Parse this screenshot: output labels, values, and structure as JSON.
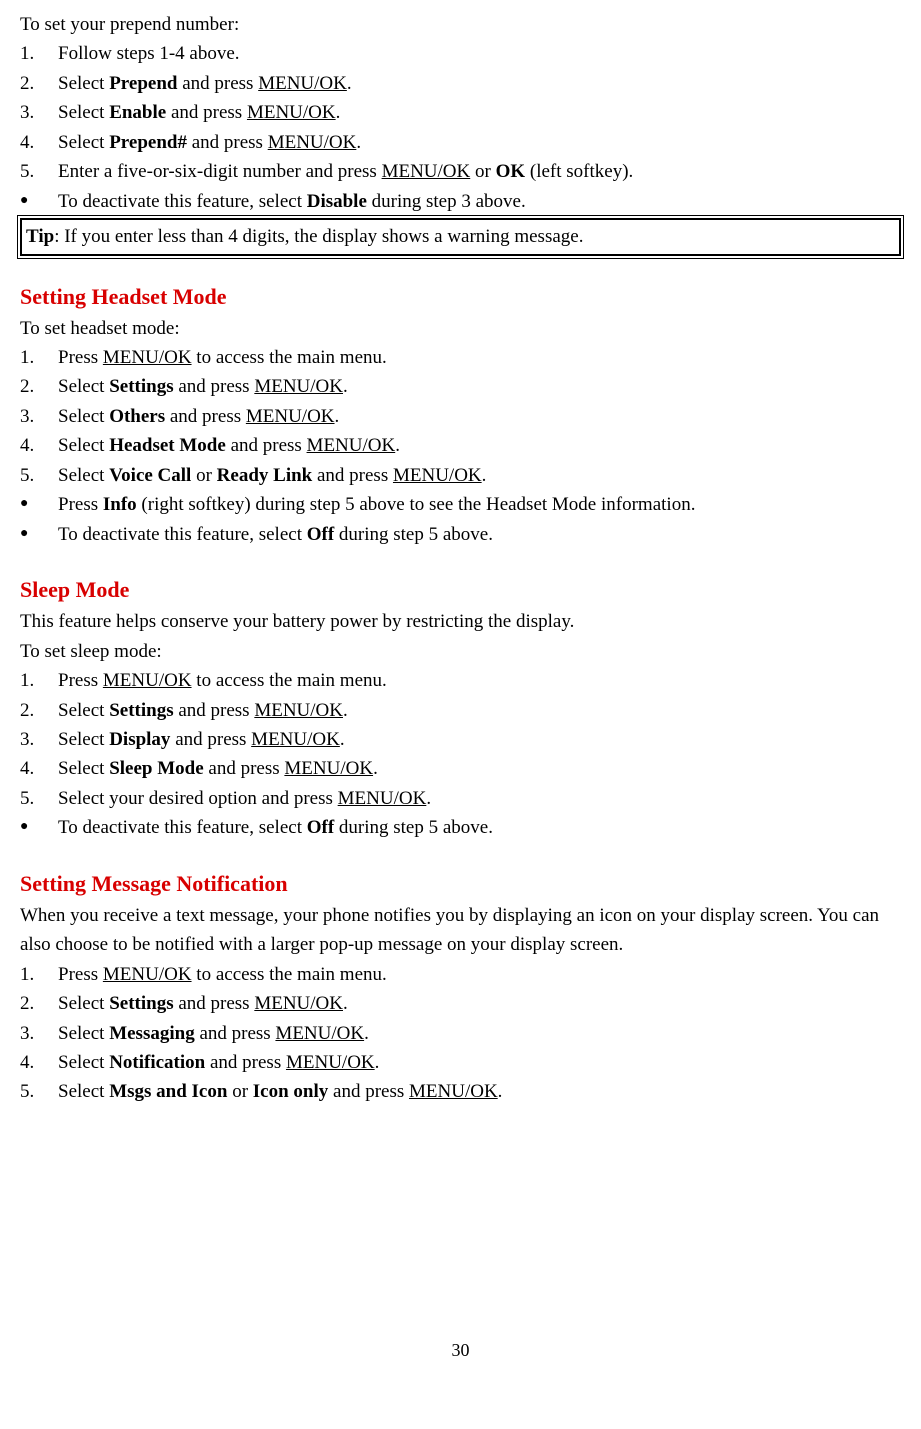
{
  "prepend": {
    "intro": "To set your prepend number:",
    "steps": [
      {
        "num": "1.",
        "html": "Follow steps 1-4 above."
      },
      {
        "num": "2.",
        "html": "Select <span class='b'>Prepend</span> and press <span class='key'>MENU/OK</span>."
      },
      {
        "num": "3.",
        "html": "Select <span class='b'>Enable</span> and press <span class='key'>MENU/OK</span>."
      },
      {
        "num": "4.",
        "html": "Select <span class='b'>Prepend#</span> and press <span class='key'>MENU/OK</span>."
      },
      {
        "num": "5.",
        "html": "Enter a five-or-six-digit number and press <span class='key'>MENU/OK</span> or <span class='b'>OK</span> (left softkey)."
      }
    ],
    "notes": [
      "To deactivate this feature, select <span class='b'>Disable</span> during step 3 above."
    ],
    "tip": "<span class='b'>Tip</span>: If you enter less than 4 digits, the display shows a warning message."
  },
  "headset": {
    "title": "Setting Headset Mode",
    "intro": "To set headset mode:",
    "steps": [
      {
        "num": "1.",
        "html": "Press <span class='key'>MENU/OK</span> to access the main menu."
      },
      {
        "num": "2.",
        "html": "Select <span class='b'>Settings</span> and press <span class='key'>MENU/OK</span>."
      },
      {
        "num": "3.",
        "html": "Select <span class='b'>Others</span> and press <span class='key'>MENU/OK</span>."
      },
      {
        "num": "4.",
        "html": "Select <span class='b'>Headset Mode</span> and press <span class='key'>MENU/OK</span>."
      },
      {
        "num": "5.",
        "html": "Select <span class='b'>Voice Call</span> or <span class='b'>Ready Link</span> and press <span class='key'>MENU/OK</span>."
      }
    ],
    "notes": [
      "Press <span class='b'>Info</span> (right softkey) during step 5 above to see the Headset Mode information.",
      "To deactivate this feature, select <span class='b'>Off</span> during step 5 above."
    ]
  },
  "sleep": {
    "title": "Sleep Mode",
    "desc": "This feature helps conserve your battery power by restricting the display.",
    "intro": "To set sleep mode:",
    "steps": [
      {
        "num": "1.",
        "html": "Press <span class='key'>MENU/OK</span> to access the main menu."
      },
      {
        "num": "2.",
        "html": "Select <span class='b'>Settings</span> and press <span class='key'>MENU/OK</span>."
      },
      {
        "num": "3.",
        "html": "Select <span class='b'>Display</span> and press <span class='key'>MENU/OK</span>."
      },
      {
        "num": "4.",
        "html": "Select <span class='b'>Sleep Mode</span> and press <span class='key'>MENU/OK</span>."
      },
      {
        "num": "5.",
        "html": "Select your desired option and press <span class='key'>MENU/OK</span>."
      }
    ],
    "notes": [
      "To deactivate this feature, select <span class='b'>Off</span> during step 5 above."
    ]
  },
  "notif": {
    "title": "Setting Message Notification",
    "desc": "When you receive a text message, your phone notifies you by displaying an icon on your display screen. You can also choose to be notified with a larger pop-up message on your display screen.",
    "steps": [
      {
        "num": "1.",
        "html": "Press <span class='key'>MENU/OK</span> to access the main menu."
      },
      {
        "num": "2.",
        "html": "Select <span class='b'>Settings</span> and press <span class='key'>MENU/OK</span>."
      },
      {
        "num": "3.",
        "html": "Select <span class='b'>Messaging</span> and press <span class='key'>MENU/OK</span>."
      },
      {
        "num": "4.",
        "html": "Select <span class='b'>Notification</span> and press <span class='key'>MENU/OK</span>."
      },
      {
        "num": "5.",
        "html": "Select <span class='b'>Msgs and Icon</span> or <span class='b'>Icon only</span> and press <span class='key'>MENU/OK</span>."
      }
    ]
  },
  "page_number": "30"
}
